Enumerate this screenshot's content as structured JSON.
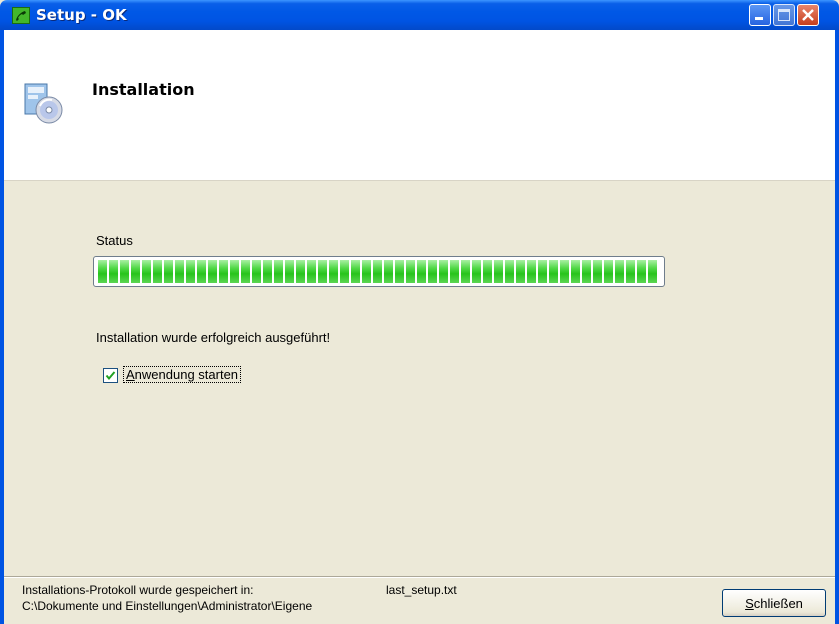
{
  "window": {
    "title": "Setup - OK",
    "icon": "green-phone-icon",
    "controls": [
      "minimize",
      "maximize",
      "close"
    ]
  },
  "header": {
    "title": "Installation",
    "icon": "setup-box-cd-icon"
  },
  "main": {
    "status_label": "Status",
    "progress_percent": 100,
    "progress_color": "#28c41c",
    "result_message": "Installation wurde erfolgreich ausgeführt!",
    "launch_checkbox": {
      "label": "Anwendung starten",
      "checked": true
    }
  },
  "footer": {
    "log_label": "Installations-Protokoll wurde gespeichert in:",
    "log_file": "last_setup.txt",
    "log_path": "C:\\Dokumente und Einstellungen\\Administrator\\Eigene",
    "close_button": {
      "accel": "S",
      "rest": "chließen"
    }
  },
  "colors": {
    "titlebar": "#0054e3",
    "dialog_bg": "#ece9d8",
    "header_bg": "#ffffff"
  }
}
